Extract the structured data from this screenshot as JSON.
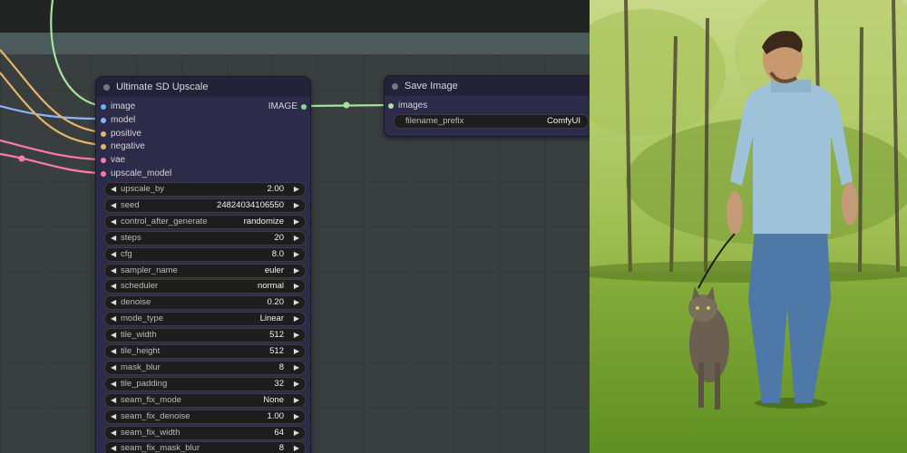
{
  "upscale_node": {
    "title": "Ultimate SD Upscale",
    "inputs": [
      {
        "label": "image",
        "color": "#64b5f6"
      },
      {
        "label": "model",
        "color": "#8ab4ff"
      },
      {
        "label": "positive",
        "color": "#e6b36a"
      },
      {
        "label": "negative",
        "color": "#e6b36a"
      },
      {
        "label": "vae",
        "color": "#ff7aa8"
      },
      {
        "label": "upscale_model",
        "color": "#ff7aa8"
      }
    ],
    "output_label": "IMAGE",
    "widgets": [
      {
        "label": "upscale_by",
        "value": "2.00"
      },
      {
        "label": "seed",
        "value": "24824034106550"
      },
      {
        "label": "control_after_generate",
        "value": "randomize"
      },
      {
        "label": "steps",
        "value": "20"
      },
      {
        "label": "cfg",
        "value": "8.0"
      },
      {
        "label": "sampler_name",
        "value": "euler"
      },
      {
        "label": "scheduler",
        "value": "normal"
      },
      {
        "label": "denoise",
        "value": "0.20"
      },
      {
        "label": "mode_type",
        "value": "Linear"
      },
      {
        "label": "tile_width",
        "value": "512"
      },
      {
        "label": "tile_height",
        "value": "512"
      },
      {
        "label": "mask_blur",
        "value": "8"
      },
      {
        "label": "tile_padding",
        "value": "32"
      },
      {
        "label": "seam_fix_mode",
        "value": "None"
      },
      {
        "label": "seam_fix_denoise",
        "value": "1.00"
      },
      {
        "label": "seam_fix_width",
        "value": "64"
      },
      {
        "label": "seam_fix_mask_blur",
        "value": "8"
      }
    ]
  },
  "save_node": {
    "title": "Save Image",
    "input_label": "images",
    "filename_label": "filename_prefix",
    "filename_value": "ComfyUI"
  },
  "colors": {
    "node_body": "#2d2b4a",
    "image_link": "#a6e3a1",
    "clip_link": "#e6b36a",
    "vae_link": "#ff7aa8",
    "model_link": "#8ab4ff"
  },
  "preview": {
    "subject": "man walking cat on leash in sunny forest meadow"
  }
}
